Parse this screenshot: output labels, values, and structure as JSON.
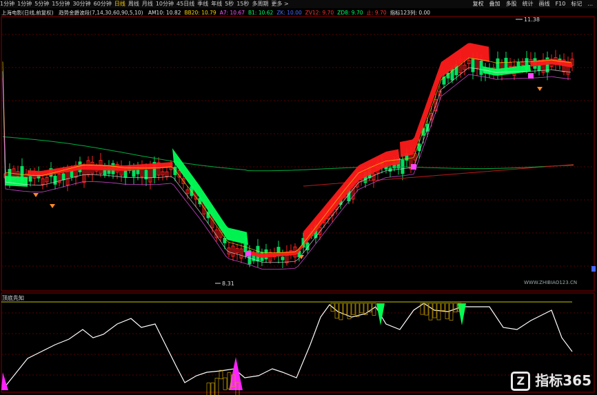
{
  "toolbar": {
    "periods": [
      "1分钟",
      "1分钟",
      "5分钟",
      "15分钟",
      "30分钟",
      "60分钟",
      "日线",
      "周线",
      "月线",
      "10分钟",
      "45日线",
      "季线",
      "年线",
      "5秒",
      "15秒",
      "多周期",
      "更多 >"
    ],
    "selected_index": 6,
    "right_tools": [
      "复权",
      "叠加",
      "多股",
      "统计",
      "画线",
      "F10",
      "标记",
      "..."
    ]
  },
  "indicators": {
    "stock": "上海电影(日线,前复权)",
    "formula": "趋势金爵波段(7,14,30,60,90,5,10)",
    "items": [
      {
        "label": "AM10: 10.82",
        "color": "#e0e0e0"
      },
      {
        "label": "BB20: 10.79",
        "color": "#ffd400"
      },
      {
        "label": "A7: 10.67",
        "color": "#ff55ff"
      },
      {
        "label": "B1: 10.62",
        "color": "#00ff66"
      },
      {
        "label": "ZK: 10.00",
        "color": "#4a6bff"
      },
      {
        "label": "ZV12: 9.70",
        "color": "#ff3030"
      },
      {
        "label": "ZD8: 9.70",
        "color": "#00ff66"
      },
      {
        "label": "止: 9.70",
        "color": "#ff3030"
      },
      {
        "label": "指标123列: 0.00",
        "color": "#e0e0e0"
      }
    ]
  },
  "annotations": {
    "high": "11.38",
    "low": "8.31",
    "watermark": "WWW.ZHIBIAO123.CN"
  },
  "sub_panel": {
    "title": "顶底先知"
  },
  "logo": "指标365",
  "colors": {
    "up": "#ff2020",
    "down": "#00e060",
    "ma_long": "#00c040",
    "grid": "#5a0000"
  }
}
